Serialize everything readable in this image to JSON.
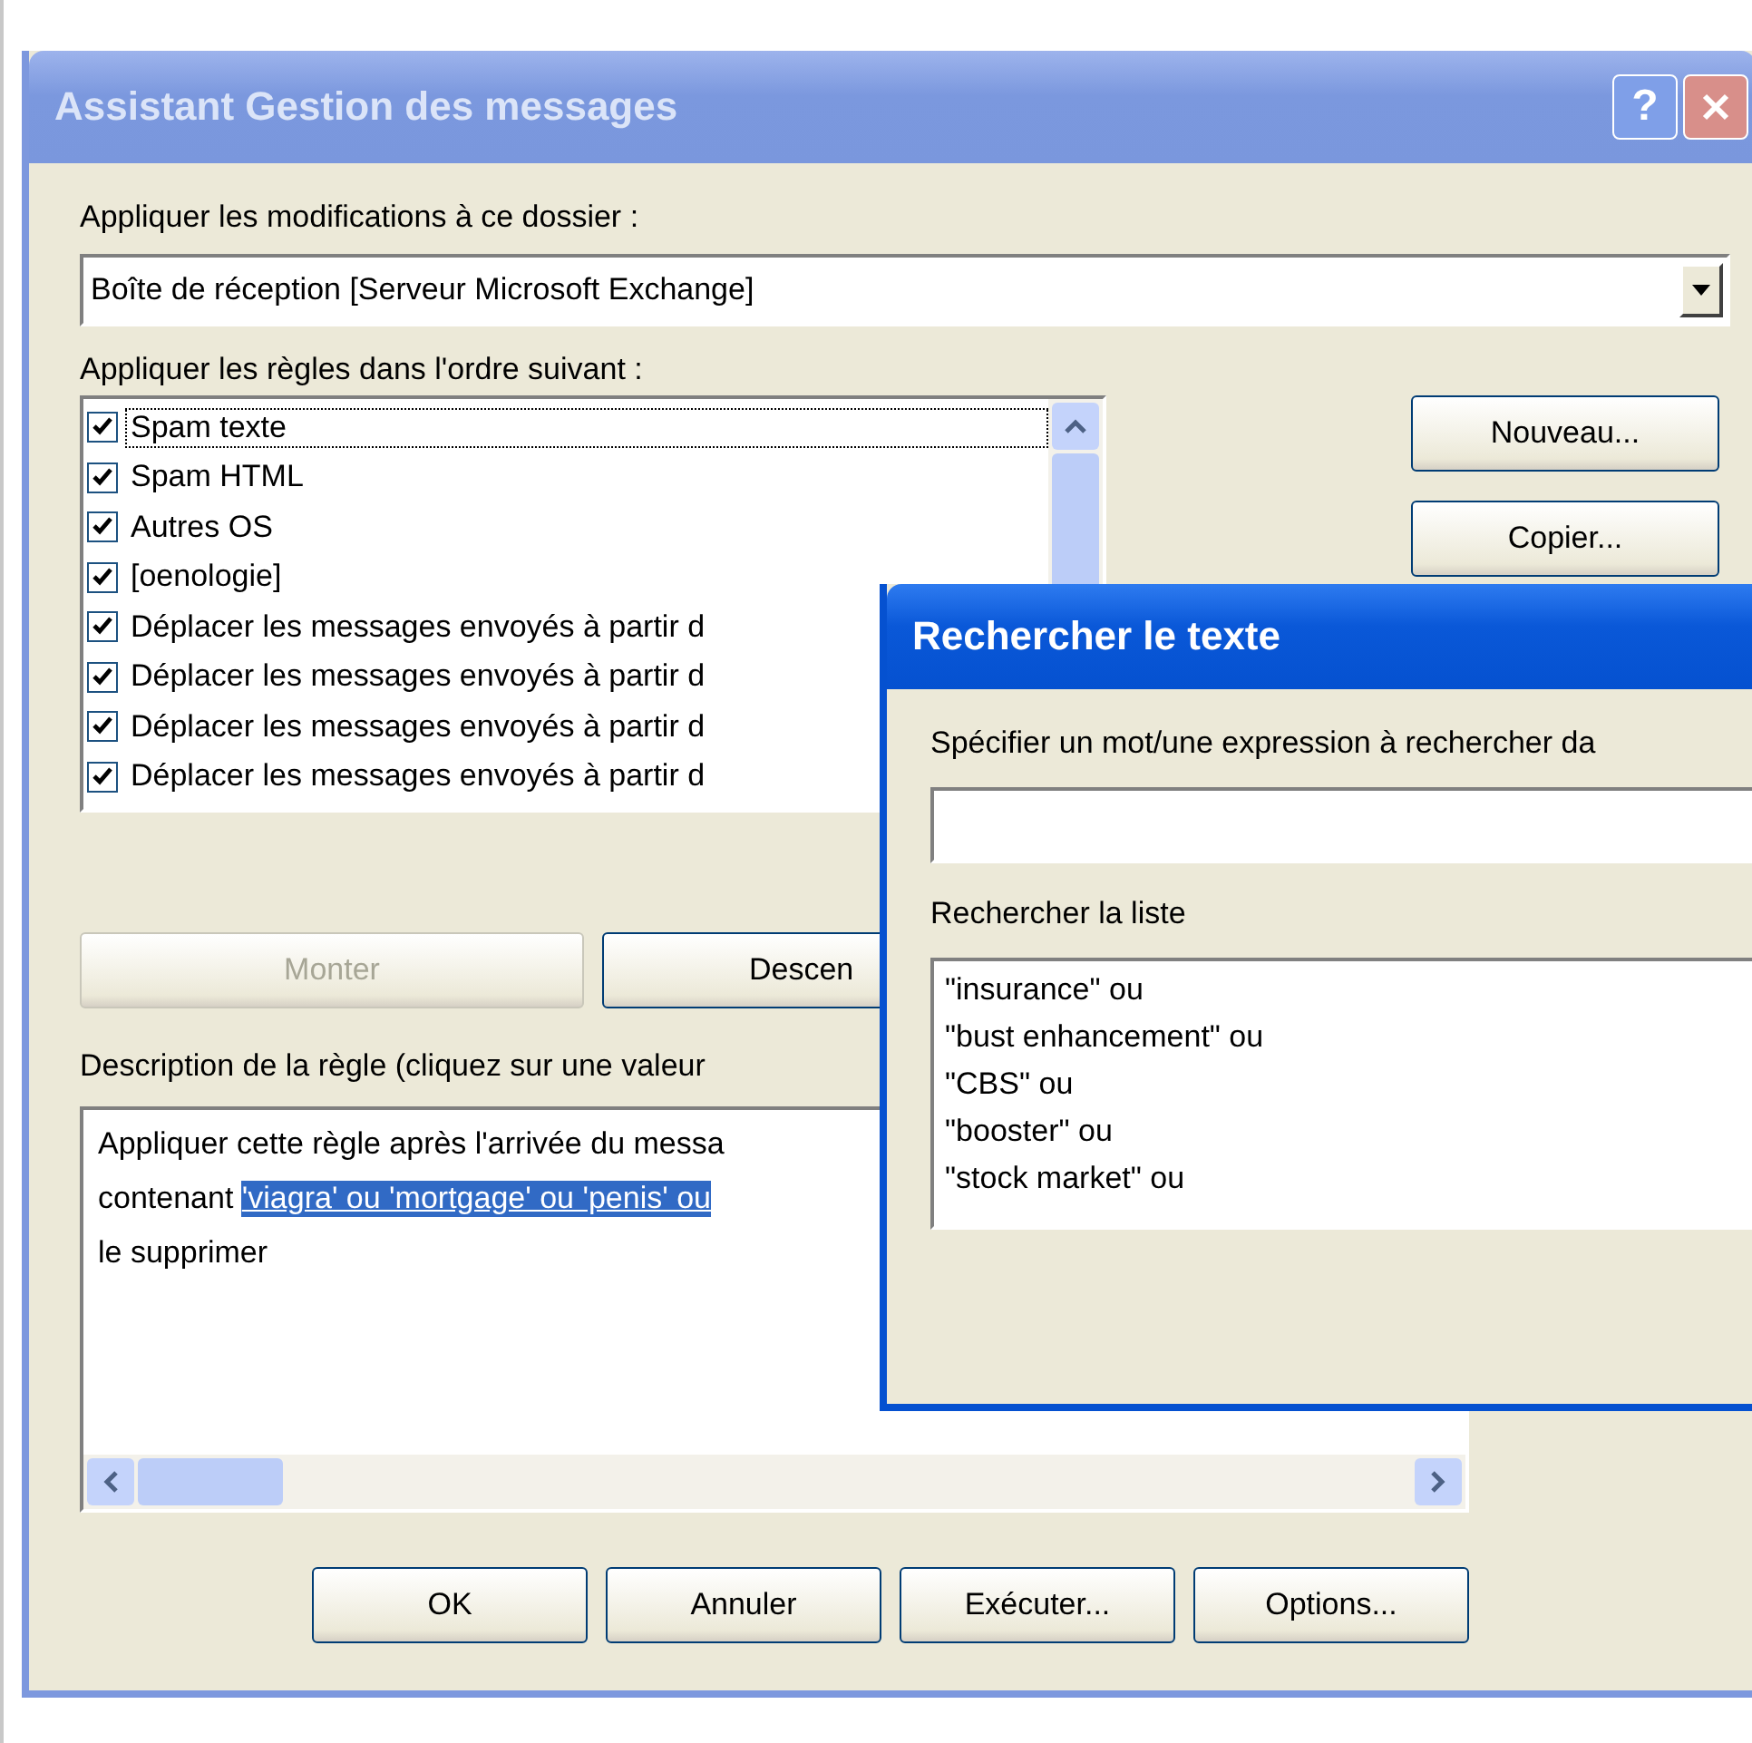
{
  "dialog": {
    "title": "Assistant Gestion des messages",
    "active": false,
    "help_button": "?",
    "folder_label": "Appliquer les modifications à ce dossier :",
    "folder_select": {
      "value": "Boîte de réception [Serveur Microsoft Exchange]"
    },
    "rules_label": "Appliquer les règles dans l'ordre suivant :",
    "rules": [
      {
        "label": "Spam texte",
        "checked": true,
        "focused": true
      },
      {
        "label": "Spam HTML",
        "checked": true,
        "focused": false
      },
      {
        "label": "Autres OS",
        "checked": true,
        "focused": false
      },
      {
        "label": "[oenologie]",
        "checked": true,
        "focused": false
      },
      {
        "label": "Déplacer les messages envoyés à partir d",
        "checked": true,
        "focused": false
      },
      {
        "label": "Déplacer les messages envoyés à partir d",
        "checked": true,
        "focused": false
      },
      {
        "label": "Déplacer les messages envoyés à partir d",
        "checked": true,
        "focused": false
      },
      {
        "label": "Déplacer les messages envoyés à partir d",
        "checked": true,
        "focused": false
      }
    ],
    "side_buttons": [
      {
        "label": "Nouveau...",
        "disabled": false
      },
      {
        "label": "Copier...",
        "disabled": false
      }
    ],
    "move_buttons": [
      {
        "label": "Monter",
        "disabled": true
      },
      {
        "label": "Descen",
        "disabled": false
      }
    ],
    "description_label": "Description de la règle (cliquez sur une valeur",
    "description_lines": [
      {
        "segments": [
          {
            "text": "Appliquer cette règle après l'arrivée du messa",
            "selected": false
          }
        ]
      },
      {
        "segments": [
          {
            "text": "contenant ",
            "selected": false
          },
          {
            "text": "'viagra' ou 'mortgage' ou 'penis' ou",
            "selected": true
          }
        ]
      },
      {
        "segments": [
          {
            "text": "le supprimer",
            "selected": false
          }
        ]
      }
    ],
    "buttons": [
      "OK",
      "Annuler",
      "Exécuter...",
      "Options..."
    ]
  },
  "find_dialog": {
    "title": "Rechercher le texte",
    "active": true,
    "prompt_label": "Spécifier un mot/une expression à rechercher da",
    "list_label": "Rechercher la liste",
    "list_items": [
      "\"insurance\" ou",
      "\"bust enhancement\" ou",
      "\"CBS\" ou",
      "\"booster\" ou",
      "\"stock market\" ou"
    ]
  }
}
